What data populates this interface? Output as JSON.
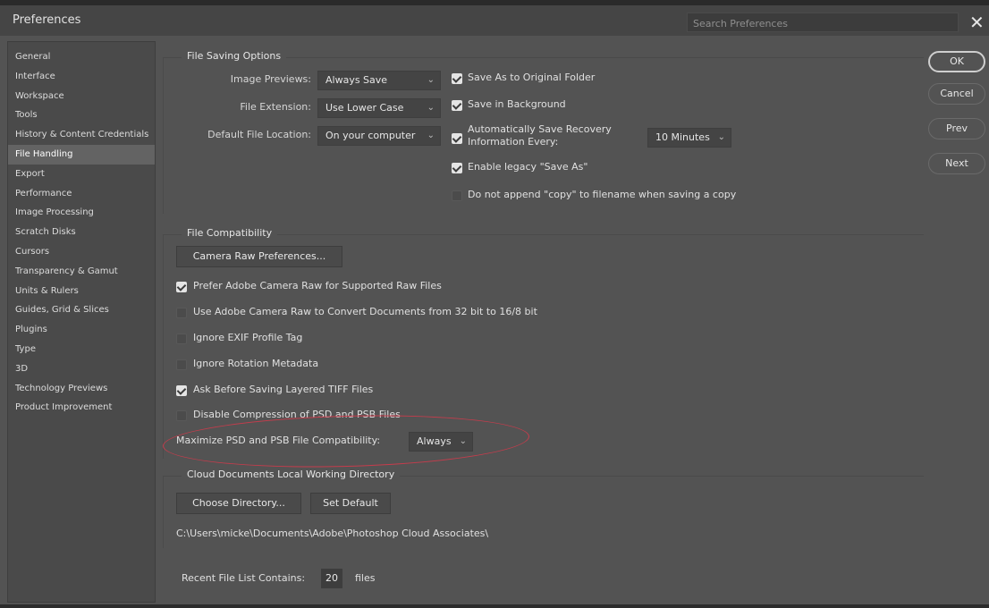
{
  "window": {
    "title": "Preferences",
    "search_placeholder": "Search Preferences",
    "close_glyph": "✕"
  },
  "sidebar": {
    "items": [
      {
        "label": "General"
      },
      {
        "label": "Interface"
      },
      {
        "label": "Workspace"
      },
      {
        "label": "Tools"
      },
      {
        "label": "History & Content Credentials"
      },
      {
        "label": "File Handling",
        "active": true
      },
      {
        "label": "Export"
      },
      {
        "label": "Performance"
      },
      {
        "label": "Image Processing"
      },
      {
        "label": "Scratch Disks"
      },
      {
        "label": "Cursors"
      },
      {
        "label": "Transparency & Gamut"
      },
      {
        "label": "Units & Rulers"
      },
      {
        "label": "Guides, Grid & Slices"
      },
      {
        "label": "Plugins"
      },
      {
        "label": "Type"
      },
      {
        "label": "3D"
      },
      {
        "label": "Technology Previews"
      },
      {
        "label": "Product Improvement"
      }
    ]
  },
  "file_saving": {
    "title": "File Saving Options",
    "image_previews": {
      "label": "Image Previews:",
      "value": "Always Save"
    },
    "file_extension": {
      "label": "File Extension:",
      "value": "Use Lower Case"
    },
    "default_location": {
      "label": "Default File Location:",
      "value": "On your computer"
    },
    "save_original_folder": {
      "label": "Save As to Original Folder",
      "checked": true
    },
    "save_background": {
      "label": "Save in Background",
      "checked": true
    },
    "auto_recovery": {
      "label_line1": "Automatically Save Recovery",
      "label_line2": "Information Every:",
      "checked": true,
      "interval": "10 Minutes"
    },
    "legacy_save_as": {
      "label": "Enable legacy \"Save As\"",
      "checked": true
    },
    "no_copy_append": {
      "label": "Do not append \"copy\" to filename when saving a copy",
      "checked": false
    }
  },
  "file_compat": {
    "title": "File Compatibility",
    "camera_raw_button": "Camera Raw Preferences...",
    "options": [
      {
        "label": "Prefer Adobe Camera Raw for Supported Raw Files",
        "checked": true
      },
      {
        "label": "Use Adobe Camera Raw to Convert Documents from 32 bit to 16/8 bit",
        "checked": false
      },
      {
        "label": "Ignore EXIF Profile Tag",
        "checked": false
      },
      {
        "label": "Ignore Rotation Metadata",
        "checked": false
      },
      {
        "label": "Ask Before Saving Layered TIFF Files",
        "checked": true
      },
      {
        "label": "Disable Compression of PSD and PSB Files",
        "checked": false
      }
    ],
    "maximize": {
      "label": "Maximize PSD and PSB File Compatibility:",
      "value": "Always"
    }
  },
  "cloud_docs": {
    "title": "Cloud Documents Local Working Directory",
    "choose_button": "Choose Directory...",
    "default_button": "Set Default",
    "path": "C:\\Users\\micke\\Documents\\Adobe\\Photoshop Cloud Associates\\"
  },
  "recent_files": {
    "label": "Recent File List Contains:",
    "count": "20",
    "unit": "files"
  },
  "buttons": {
    "ok": "OK",
    "cancel": "Cancel",
    "prev": "Prev",
    "next": "Next"
  },
  "colors": {
    "background": "#535353",
    "highlight_ellipse": "#c63c4c"
  }
}
